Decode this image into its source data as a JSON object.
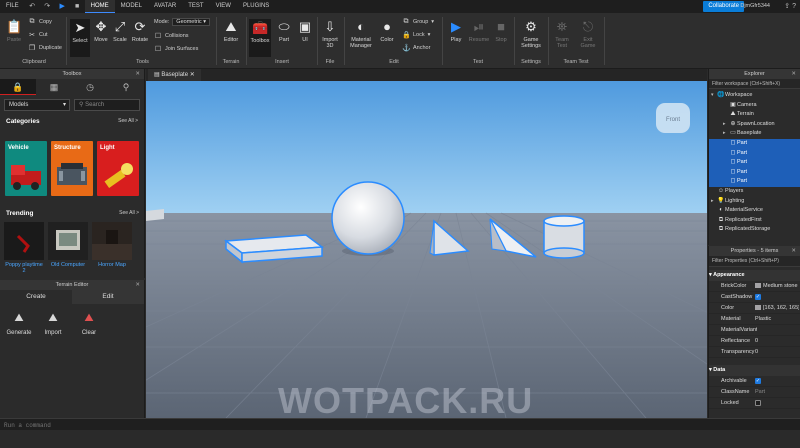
{
  "menubar": {
    "items": [
      "FILE",
      "HOME",
      "MODEL",
      "AVATAR",
      "TEST",
      "VIEW",
      "PLUGINS"
    ],
    "active": "HOME",
    "collaborate": "Collaborate",
    "user": "DjmGfr5344"
  },
  "ribbon": {
    "clipboard": {
      "paste": "Paste",
      "copy": "Copy",
      "cut": "Cut",
      "duplicate": "Duplicate",
      "group": "Clipboard"
    },
    "tools": {
      "select": "Select",
      "move": "Move",
      "scale": "Scale",
      "rotate": "Rotate",
      "group": "Tools",
      "mode_label": "Mode:",
      "mode_value": "Geometric",
      "collisions": "Collisions",
      "join_surfaces": "Join Surfaces"
    },
    "terrain": {
      "editor": "Editor",
      "group": "Terrain"
    },
    "insert": {
      "toolbox": "Toolbox",
      "part": "Part",
      "ui": "UI",
      "group": "Insert"
    },
    "file": {
      "import3d": "Import 3D",
      "group": "File"
    },
    "edit": {
      "material_manager": "Material Manager",
      "color": "Color",
      "group_btn": "Group",
      "lock": "Lock",
      "anchor": "Anchor",
      "group": "Edit"
    },
    "test": {
      "play": "Play",
      "resume": "Resume",
      "stop": "Stop",
      "group": "Test"
    },
    "settings": {
      "game_settings": "Game Settings",
      "group": "Settings"
    },
    "team_test": {
      "team_test": "Team Test",
      "exit_game": "Exit Game",
      "group": "Team Test"
    }
  },
  "toolbox": {
    "title": "Toolbox",
    "tabs": [
      "lock-icon",
      "grid-icon",
      "clock-icon",
      "pin-icon"
    ],
    "select_value": "Models",
    "search_placeholder": "Search",
    "categories_heading": "Categories",
    "see_all": "See All >",
    "categories": [
      {
        "label": "Vehicle",
        "color": "#0f8a7f"
      },
      {
        "label": "Structure",
        "color": "#e86a16"
      },
      {
        "label": "Light",
        "color": "#d81e1e"
      }
    ],
    "trending_heading": "Trending",
    "trending": [
      "Poppy playtime 2",
      "Old Computer",
      "Horror Map"
    ]
  },
  "terrain_editor": {
    "title": "Terrain Editor",
    "tabs": [
      "Create",
      "Edit"
    ],
    "active_tab": "Create",
    "buttons": [
      "Generate",
      "Import",
      "Clear"
    ]
  },
  "viewport": {
    "tab": "Baseplate",
    "view_cube_label": "Front",
    "sky_color": "#6eb2e8",
    "floor_color": "#6e7888",
    "selection_color": "#2b8cff"
  },
  "explorer": {
    "title": "Explorer",
    "filter": "Filter workspace (Ctrl+Shift+X)",
    "items": [
      {
        "label": "Workspace",
        "depth": 0,
        "expanded": true,
        "selected": false
      },
      {
        "label": "Camera",
        "depth": 1,
        "expanded": null,
        "selected": false
      },
      {
        "label": "Terrain",
        "depth": 1,
        "expanded": null,
        "selected": false
      },
      {
        "label": "SpawnLocation",
        "depth": 1,
        "expanded": false,
        "selected": false
      },
      {
        "label": "Baseplate",
        "depth": 1,
        "expanded": false,
        "selected": false
      },
      {
        "label": "Part",
        "depth": 1,
        "expanded": null,
        "selected": true
      },
      {
        "label": "Part",
        "depth": 1,
        "expanded": null,
        "selected": true
      },
      {
        "label": "Part",
        "depth": 1,
        "expanded": null,
        "selected": true
      },
      {
        "label": "Part",
        "depth": 1,
        "expanded": null,
        "selected": true
      },
      {
        "label": "Part",
        "depth": 1,
        "expanded": null,
        "selected": true
      },
      {
        "label": "Players",
        "depth": 0,
        "expanded": null,
        "selected": false
      },
      {
        "label": "Lighting",
        "depth": 0,
        "expanded": false,
        "selected": false
      },
      {
        "label": "MaterialService",
        "depth": 0,
        "expanded": null,
        "selected": false
      },
      {
        "label": "ReplicatedFirst",
        "depth": 0,
        "expanded": null,
        "selected": false
      },
      {
        "label": "ReplicatedStorage",
        "depth": 0,
        "expanded": null,
        "selected": false
      }
    ]
  },
  "properties": {
    "title": "Properties - 5 items",
    "filter": "Filter Properties (Ctrl+Shift+P)",
    "appearance_heading": "Appearance",
    "rows": [
      {
        "k": "BrickColor",
        "v": "Medium stone grey",
        "kind": "swatch"
      },
      {
        "k": "CastShadow",
        "v": "",
        "kind": "check"
      },
      {
        "k": "Color",
        "v": "[163, 162, 165]",
        "kind": "swatch"
      },
      {
        "k": "Material",
        "v": "Plastic",
        "kind": "text"
      },
      {
        "k": "MaterialVariant",
        "v": "",
        "kind": "text"
      },
      {
        "k": "Reflectance",
        "v": "0",
        "kind": "text"
      },
      {
        "k": "Transparency",
        "v": "0",
        "kind": "text"
      }
    ],
    "data_heading": "Data",
    "data_rows": [
      {
        "k": "Archivable",
        "v": "",
        "kind": "check"
      },
      {
        "k": "ClassName",
        "v": "Part",
        "kind": "muted"
      },
      {
        "k": "Locked",
        "v": "",
        "kind": "uncheck"
      }
    ]
  },
  "command_bar": {
    "placeholder": "Run a command"
  },
  "watermark": "WOTPACK.RU"
}
